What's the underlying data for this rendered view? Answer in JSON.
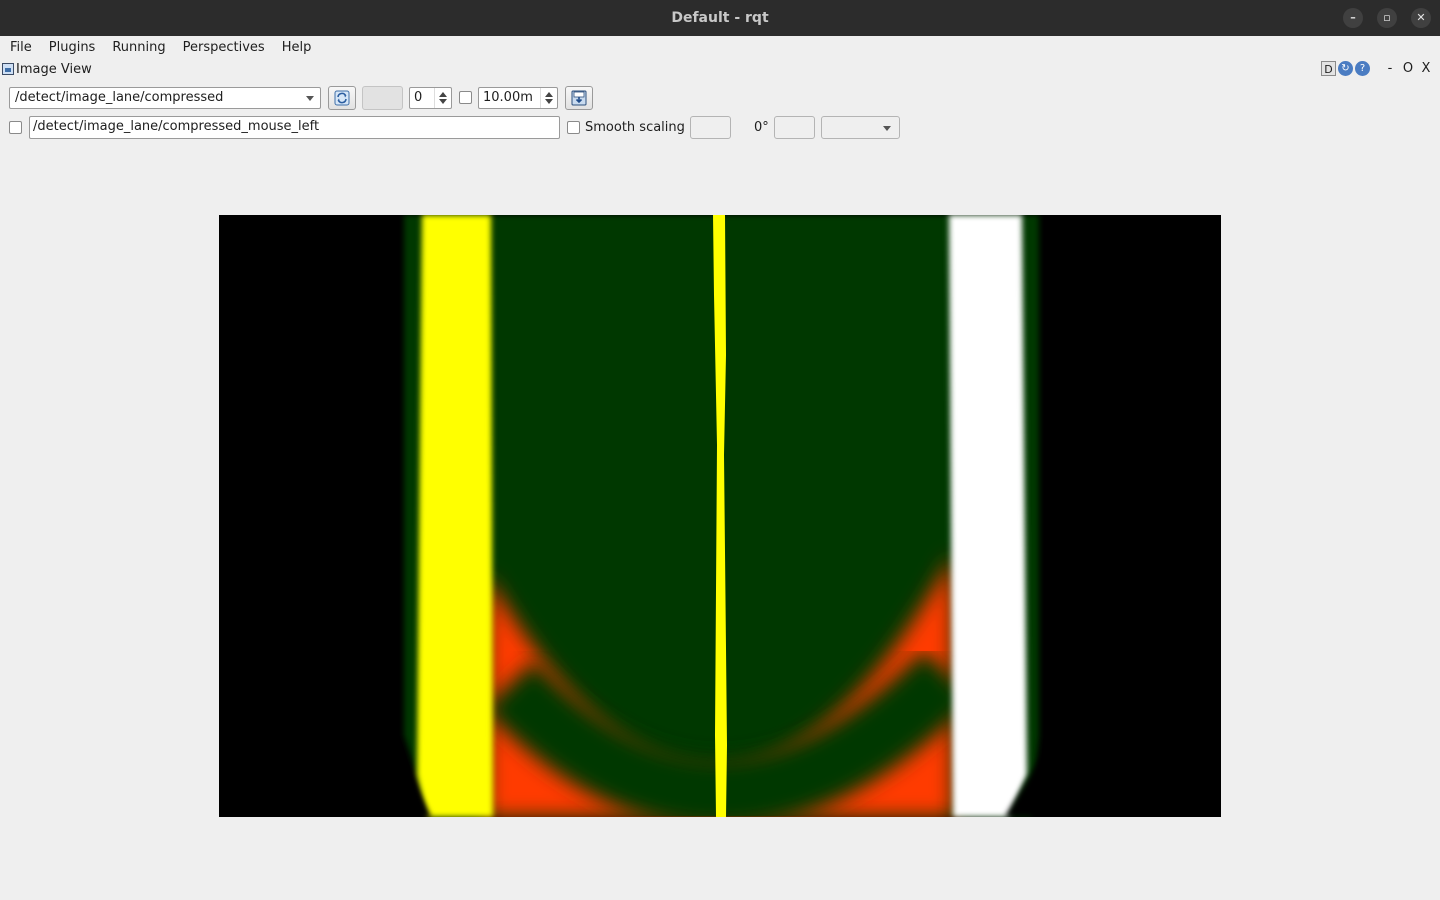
{
  "window": {
    "title": "Default - rqt",
    "controls": {
      "minimize": "–",
      "maximize": "▫",
      "close": "✕"
    }
  },
  "menu": [
    "File",
    "Plugins",
    "Running",
    "Perspectives",
    "Help"
  ],
  "plugin": {
    "title": "Image View",
    "icons": [
      "image-icon"
    ],
    "dock_controls": {
      "help_badge": "D",
      "minimize": "-",
      "float": "O",
      "close": "X"
    }
  },
  "toolbar": {
    "topic": "/detect/image_lane/compressed",
    "spin_value": "0",
    "max_range": "10.00m",
    "mouse_topic": "/detect/image_lane/compressed_mouse_left",
    "smooth_scaling_label": "Smooth scaling",
    "rotation_label": "0°"
  },
  "image": {
    "colors": {
      "background": "#000000",
      "lane_green": "#033900",
      "left_line": "#ffff00",
      "center_line": "#ffff00",
      "right_line": "#ffffff",
      "marker": "#ff3a00"
    }
  }
}
